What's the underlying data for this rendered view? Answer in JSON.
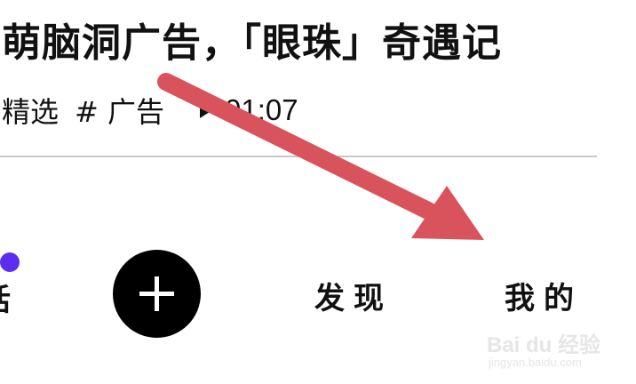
{
  "video": {
    "title": "萌脑洞广告，「眼珠」奇遇记",
    "tags": [
      "精选",
      "# 广告"
    ],
    "duration": "01:07"
  },
  "tabbar": {
    "partial_tab_label": "话",
    "badge_color": "#5b2ef0",
    "add_icon": "plus-icon",
    "discover_label": "发现",
    "mine_label": "我的"
  },
  "annotation": {
    "arrow_color": "#d9535c",
    "arrow_icon": "arrow-pointer-icon"
  },
  "watermark": {
    "main": "Bai du 经验",
    "sub": "jingyan.baidu.com"
  }
}
